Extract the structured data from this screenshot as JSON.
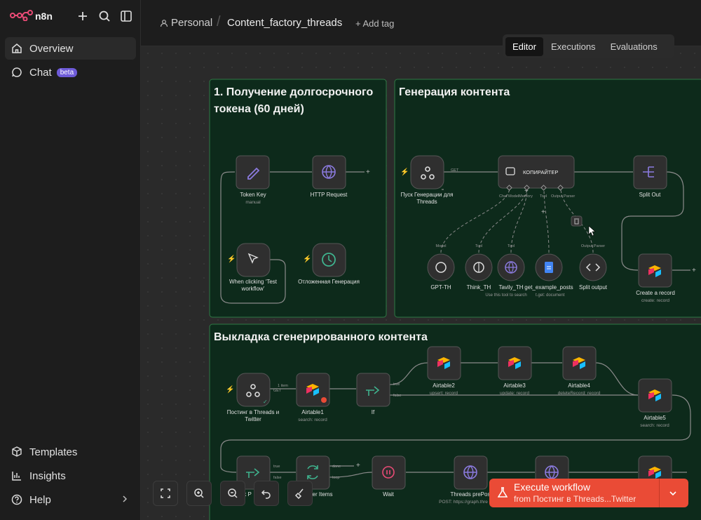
{
  "app": {
    "logo_text": "n8n"
  },
  "sidebar": {
    "items": [
      {
        "label": "Overview",
        "icon": "home-icon"
      },
      {
        "label": "Chat",
        "icon": "chat-icon",
        "badge": "beta"
      }
    ],
    "bottom": [
      {
        "label": "Templates",
        "icon": "box-icon"
      },
      {
        "label": "Insights",
        "icon": "chart-icon"
      },
      {
        "label": "Help",
        "icon": "help-icon"
      }
    ]
  },
  "header": {
    "project": "Personal",
    "workflow_name": "Content_factory_threads",
    "add_tag": "+ Add tag",
    "tabs": [
      "Editor",
      "Executions",
      "Evaluations"
    ],
    "active_tab": "Editor"
  },
  "canvas": {
    "stickies": [
      {
        "title_line1": "1. Получение долгосрочного",
        "title_line2": "токена (60 дней)"
      },
      {
        "title_line1": "Генерация контента",
        "title_line2": ""
      },
      {
        "title_line1": "Выкладка сгенерированного контента",
        "title_line2": ""
      }
    ],
    "nodes": {
      "token_key": {
        "label": "Token Key",
        "sub": "manual"
      },
      "http_request": {
        "label": "HTTP Request",
        "sub": ""
      },
      "test_click": {
        "label1": "When clicking ‘Test",
        "label2": "workflow’"
      },
      "delayed": {
        "label": "Отложенная Генерация"
      },
      "start_gen": {
        "label1": "Пуск Генерации для",
        "label2": "Threads",
        "edge": "GET"
      },
      "copywriter": {
        "label": "КОПИРАЙТЕР",
        "ports": [
          "Chat Model",
          "Memory",
          "Tool",
          "Output Parser"
        ]
      },
      "split_out": {
        "label": "Split Out"
      },
      "gpt": {
        "label": "GPT-TH",
        "role": "Model"
      },
      "think": {
        "label": "Think_TH",
        "role": "Tool"
      },
      "tavily": {
        "label": "Tavily_TH",
        "role": "Tool",
        "sub": "Use this tool to search"
      },
      "get_posts": {
        "label": "get_example_posts",
        "sub": "t.get: document"
      },
      "split_output": {
        "label": "Split output",
        "role": "Output Parser"
      },
      "create_record": {
        "label": "Create a record",
        "sub": "create: record"
      },
      "post_threads": {
        "label1": "Постинг в Threads и",
        "label2": "Twitter",
        "edge1": "1 item",
        "edge2": "GET"
      },
      "airtable1": {
        "label": "Airtable1",
        "sub": "search: record"
      },
      "if_node": {
        "label": "If",
        "true": "true",
        "false": "false"
      },
      "airtable2": {
        "label": "Airtable2",
        "sub": "upsert: record"
      },
      "airtable3": {
        "label": "Airtable3",
        "sub": "update: record"
      },
      "airtable4": {
        "label": "Airtable4",
        "sub": "deleteRecord: record"
      },
      "airtable5": {
        "label": "Airtable5",
        "sub": "search: record"
      },
      "loop": {
        "label": "ver Items",
        "done": "done",
        "loop": "loop"
      },
      "if2": {
        "label": "k P",
        "true": "true",
        "false": "false"
      },
      "wait": {
        "label": "Wait"
      },
      "threads_pre": {
        "label": "Threads prePos",
        "sub": "POST: https://graph.thre"
      }
    }
  },
  "execute": {
    "title": "Execute workflow",
    "subtitle": "from Постинг в Threads...Twitter"
  },
  "colors": {
    "accent": "#ea4b36",
    "sticky_bg": "#0d2a1b",
    "sticky_border": "#2f7a45"
  }
}
